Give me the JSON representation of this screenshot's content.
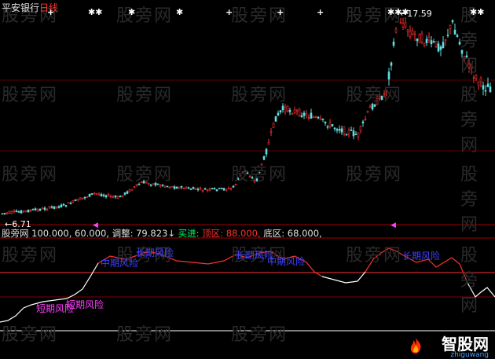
{
  "header": {
    "stock_name": "平安银行",
    "period": "日线"
  },
  "price_labels": {
    "high": "←17.59",
    "low": "←6.71"
  },
  "indicator_header": {
    "name": "股旁网",
    "params": "100.000, 60.000,",
    "adjust_label": "调整:",
    "adjust_value": "79.823↓",
    "buy_label": "买进:",
    "top_label": "顶区:",
    "top_value": "88.000,",
    "bottom_label": "底区:",
    "bottom_value": "68.000,"
  },
  "annotations": {
    "short_risk_1": "短期风险",
    "short_risk_2": "短期风险",
    "mid_risk_1": "中期风险",
    "mid_risk_2": "中期风险",
    "long_risk_1": "长期风险",
    "long_risk_2": "长期风险"
  },
  "watermark": "股旁网",
  "logo": {
    "name": "智股网",
    "url": "zhiguwang"
  },
  "colors": {
    "up": "#ff3030",
    "down": "#60e0e0",
    "line_red": "#ff3030",
    "line_white": "#ffffff",
    "top_level": "#ff3030",
    "bottom_level": "#ffffff"
  }
}
